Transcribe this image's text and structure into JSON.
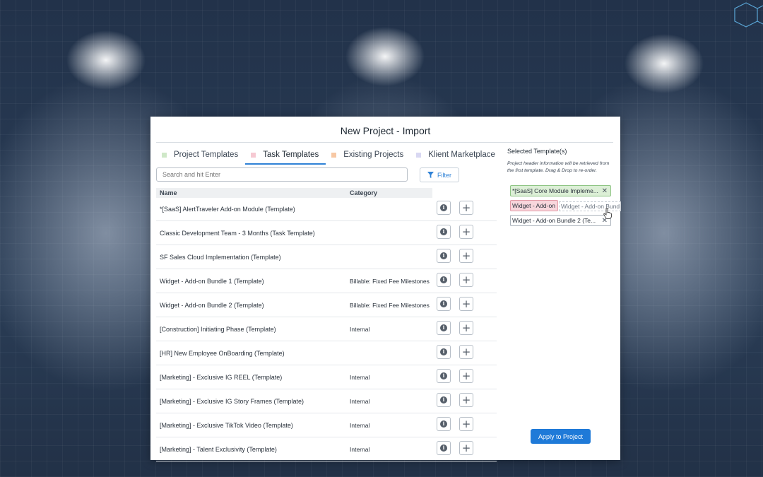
{
  "modal": {
    "title": "New Project - Import"
  },
  "tabs": [
    {
      "label": "Project Templates",
      "color": "#cfe8c8",
      "active": false
    },
    {
      "label": "Task Templates",
      "color": "#f6c9d2",
      "active": true
    },
    {
      "label": "Existing Projects",
      "color": "#f7c8a4",
      "active": false
    },
    {
      "label": "Klient Marketplace",
      "color": "#d9d8f2",
      "active": false
    }
  ],
  "search": {
    "placeholder": "Search and hit Enter",
    "value": ""
  },
  "filter": {
    "label": "Filter",
    "icon": "filter-icon"
  },
  "table": {
    "headers": {
      "name": "Name",
      "category": "Category"
    },
    "rows": [
      {
        "name": "*[SaaS] AlertTraveler Add-on Module (Template)",
        "category": ""
      },
      {
        "name": "Classic Development Team - 3 Months (Task Template)",
        "category": ""
      },
      {
        "name": "SF Sales Cloud Implementation (Template)",
        "category": ""
      },
      {
        "name": "Widget - Add-on Bundle 1 (Template)",
        "category": "Billable: Fixed Fee Milestones"
      },
      {
        "name": "Widget - Add-on Bundle 2 (Template)",
        "category": "Billable: Fixed Fee Milestones"
      },
      {
        "name": "[Construction] Initiating Phase (Template)",
        "category": "Internal"
      },
      {
        "name": "[HR] New Employee OnBoarding (Template)",
        "category": ""
      },
      {
        "name": "[Marketing] - Exclusive IG REEL (Template)",
        "category": "Internal"
      },
      {
        "name": "[Marketing] - Exclusive IG Story Frames (Template)",
        "category": "Internal"
      },
      {
        "name": "[Marketing] - Exclusive TikTok Video (Template)",
        "category": "Internal"
      },
      {
        "name": "[Marketing] - Talent Exclusivity (Template)",
        "category": "Internal"
      }
    ]
  },
  "selected": {
    "title": "Selected Template(s)",
    "note": "Project header information will be retrieved from the first template. Drag & Drop to re-order.",
    "chips": [
      {
        "label": "*[SaaS] Core Module Impleme...",
        "close": "✕",
        "color": "#dcefd6"
      },
      {
        "label": "Widget - Add-on",
        "close": "",
        "color": "#f8d6dc"
      },
      {
        "label": "Widget - Add-on Bundle 2 (Te...",
        "close": "✕",
        "color": "#ffffff"
      }
    ],
    "drag_ghost": "Widget - Add-on Bund"
  },
  "apply_button": "Apply to Project",
  "colors": {
    "accent": "#1f7ad8",
    "tab_underline": "#2f82d6"
  }
}
